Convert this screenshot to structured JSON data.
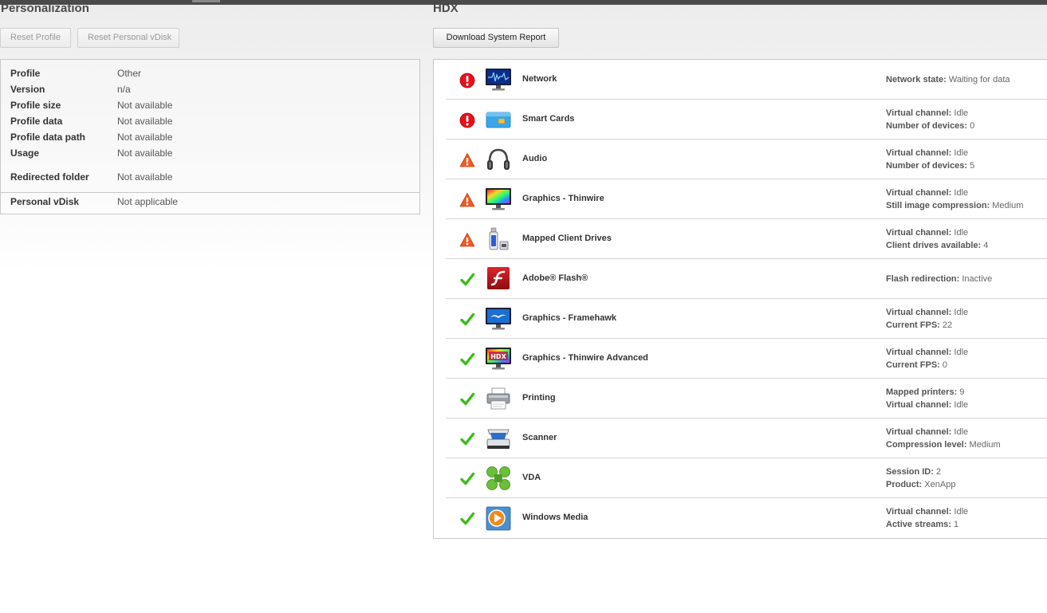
{
  "personalization": {
    "title": "Personalization",
    "reset_profile_label": "Reset Profile",
    "reset_vdisk_label": "Reset Personal vDisk",
    "rows": [
      {
        "key": "Profile",
        "value": "Other"
      },
      {
        "key": "Version",
        "value": "n/a"
      },
      {
        "key": "Profile size",
        "value": "Not available"
      },
      {
        "key": "Profile data",
        "value": "Not available"
      },
      {
        "key": "Profile data path",
        "value": "Not available"
      },
      {
        "key": "Usage",
        "value": "Not available"
      },
      {
        "key": "Redirected folder",
        "value": "Not available"
      }
    ],
    "vdisk": {
      "key": "Personal vDisk",
      "value": "Not applicable"
    }
  },
  "hdx": {
    "title": "HDX",
    "download_label": "Download System Report",
    "items": [
      {
        "name": "Network",
        "status": "error",
        "icon": "network-monitor-icon",
        "info": [
          {
            "label": "Network state:",
            "value": "Waiting for data"
          }
        ]
      },
      {
        "name": "Smart Cards",
        "status": "error",
        "icon": "smart-card-icon",
        "info": [
          {
            "label": "Virtual channel:",
            "value": "Idle"
          },
          {
            "label": "Number of devices:",
            "value": "0"
          }
        ]
      },
      {
        "name": "Audio",
        "status": "warning",
        "icon": "headphones-icon",
        "info": [
          {
            "label": "Virtual channel:",
            "value": "Idle"
          },
          {
            "label": "Number of devices:",
            "value": "5"
          }
        ]
      },
      {
        "name": "Graphics - Thinwire",
        "status": "warning",
        "icon": "color-monitor-icon",
        "info": [
          {
            "label": "Virtual channel:",
            "value": "Idle"
          },
          {
            "label": "Still image compression:",
            "value": "Medium"
          }
        ]
      },
      {
        "name": "Mapped Client Drives",
        "status": "warning",
        "icon": "usb-drive-icon",
        "info": [
          {
            "label": "Virtual channel:",
            "value": "Idle"
          },
          {
            "label": "Client drives available:",
            "value": "4"
          }
        ]
      },
      {
        "name": "Adobe® Flash®",
        "status": "ok",
        "icon": "flash-icon",
        "info": [
          {
            "label": "Flash redirection:",
            "value": "Inactive"
          }
        ]
      },
      {
        "name": "Graphics - Framehawk",
        "status": "ok",
        "icon": "framehawk-monitor-icon",
        "info": [
          {
            "label": "Virtual channel:",
            "value": "Idle"
          },
          {
            "label": "Current FPS:",
            "value": "22"
          }
        ]
      },
      {
        "name": "Graphics - Thinwire Advanced",
        "status": "ok",
        "icon": "hdx-monitor-icon",
        "info": [
          {
            "label": "Virtual channel:",
            "value": "Idle"
          },
          {
            "label": "Current FPS:",
            "value": "0"
          }
        ]
      },
      {
        "name": "Printing",
        "status": "ok",
        "icon": "printer-icon",
        "info": [
          {
            "label": "Mapped printers:",
            "value": "9"
          },
          {
            "label": "Virtual channel:",
            "value": "Idle"
          }
        ]
      },
      {
        "name": "Scanner",
        "status": "ok",
        "icon": "scanner-icon",
        "info": [
          {
            "label": "Virtual channel:",
            "value": "Idle"
          },
          {
            "label": "Compression level:",
            "value": "Medium"
          }
        ]
      },
      {
        "name": "VDA",
        "status": "ok",
        "icon": "vda-icon",
        "info": [
          {
            "label": "Session ID:",
            "value": "2"
          },
          {
            "label": "Product:",
            "value": "XenApp"
          }
        ]
      },
      {
        "name": "Windows Media",
        "status": "ok",
        "icon": "windows-media-icon",
        "info": [
          {
            "label": "Virtual channel:",
            "value": "Idle"
          },
          {
            "label": "Active streams:",
            "value": "1"
          }
        ]
      }
    ]
  },
  "colors": {
    "error": "#e8101a",
    "warning": "#ef5a24",
    "ok": "#3dbb1c"
  }
}
